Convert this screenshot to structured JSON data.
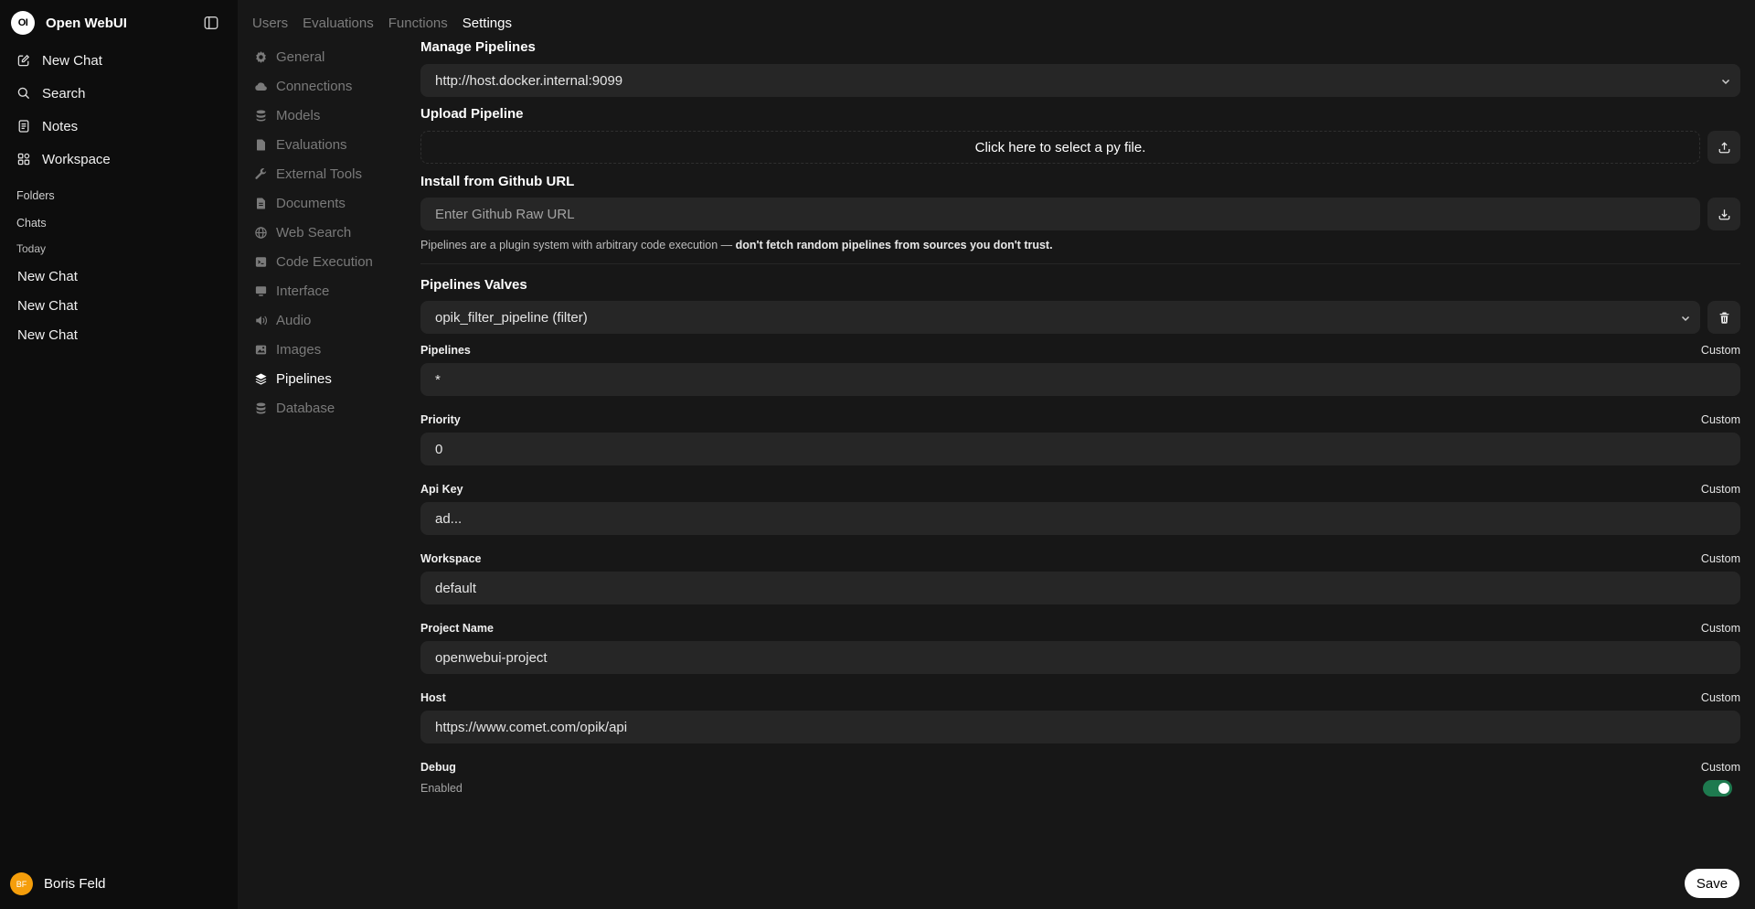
{
  "app": {
    "title": "Open WebUI",
    "logo_text": "OI"
  },
  "sidebar": {
    "nav": [
      {
        "label": "New Chat",
        "icon": "pencil-square-icon"
      },
      {
        "label": "Search",
        "icon": "search-icon"
      },
      {
        "label": "Notes",
        "icon": "notes-icon"
      },
      {
        "label": "Workspace",
        "icon": "workspace-icon"
      }
    ],
    "folders_label": "Folders",
    "chats_label": "Chats",
    "today_label": "Today",
    "chats": [
      "New Chat",
      "New Chat",
      "New Chat"
    ],
    "user": {
      "initials": "BF",
      "name": "Boris Feld"
    }
  },
  "tabs": [
    "Users",
    "Evaluations",
    "Functions",
    "Settings"
  ],
  "settings_menu": [
    {
      "label": "General",
      "icon": "gear-icon"
    },
    {
      "label": "Connections",
      "icon": "cloud-icon"
    },
    {
      "label": "Models",
      "icon": "database-stack-icon"
    },
    {
      "label": "Evaluations",
      "icon": "document-icon"
    },
    {
      "label": "External Tools",
      "icon": "wrench-icon"
    },
    {
      "label": "Documents",
      "icon": "document-text-icon"
    },
    {
      "label": "Web Search",
      "icon": "globe-icon"
    },
    {
      "label": "Code Execution",
      "icon": "code-icon"
    },
    {
      "label": "Interface",
      "icon": "monitor-icon"
    },
    {
      "label": "Audio",
      "icon": "speaker-icon"
    },
    {
      "label": "Images",
      "icon": "image-icon"
    },
    {
      "label": "Pipelines",
      "icon": "layers-icon"
    },
    {
      "label": "Database",
      "icon": "database-icon"
    }
  ],
  "pipelines": {
    "manage_title": "Manage Pipelines",
    "manage_url": "http://host.docker.internal:9099",
    "upload_title": "Upload Pipeline",
    "upload_text": "Click here to select a py file.",
    "github_title": "Install from Github URL",
    "github_placeholder": "Enter Github Raw URL",
    "note_prefix": "Pipelines are a plugin system with arbitrary code execution —",
    "note_bold": "don't fetch random pipelines from sources you don't trust.",
    "valves_title": "Pipelines Valves",
    "valve_selected": "opik_filter_pipeline (filter)",
    "custom_label": "Custom",
    "fields": [
      {
        "label": "Pipelines",
        "value": "*"
      },
      {
        "label": "Priority",
        "value": "0"
      },
      {
        "label": "Api Key",
        "value": "ad..."
      },
      {
        "label": "Workspace",
        "value": "default"
      },
      {
        "label": "Project Name",
        "value": "openwebui-project"
      },
      {
        "label": "Host",
        "value": "https://www.comet.com/opik/api"
      }
    ],
    "debug": {
      "label": "Debug",
      "status": "Enabled",
      "on": true
    },
    "save_label": "Save"
  },
  "colors": {
    "toggle_on": "#1e7a4f",
    "avatar": "#f59e0b"
  }
}
